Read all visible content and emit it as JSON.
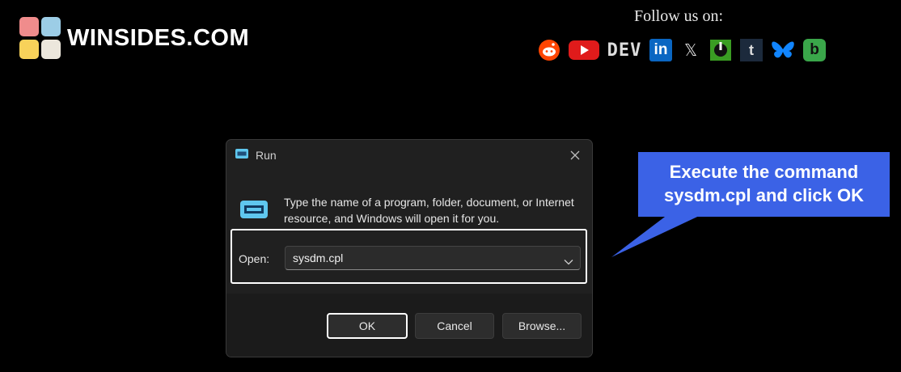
{
  "brand": {
    "name": "WINSIDES.COM"
  },
  "follow": {
    "label": "Follow us on:"
  },
  "socials": [
    {
      "name": "reddit-icon"
    },
    {
      "name": "youtube-icon"
    },
    {
      "name": "dev-icon",
      "label": "DEV"
    },
    {
      "name": "linkedin-icon",
      "label": "in"
    },
    {
      "name": "x-icon",
      "label": "𝕏"
    },
    {
      "name": "ko-fi-icon"
    },
    {
      "name": "tumblr-icon",
      "label": "t"
    },
    {
      "name": "bluesky-icon"
    },
    {
      "name": "blogger-icon",
      "label": "b"
    }
  ],
  "dialog": {
    "title": "Run",
    "description": "Type the name of a program, folder, document, or Internet resource, and Windows will open it for you.",
    "open_label": "Open:",
    "open_value": "sysdm.cpl",
    "ok_label": "OK",
    "cancel_label": "Cancel",
    "browse_label": "Browse..."
  },
  "callout": {
    "line1": "Execute the command",
    "line2": "sysdm.cpl and click OK",
    "color": "#3b62e6"
  }
}
